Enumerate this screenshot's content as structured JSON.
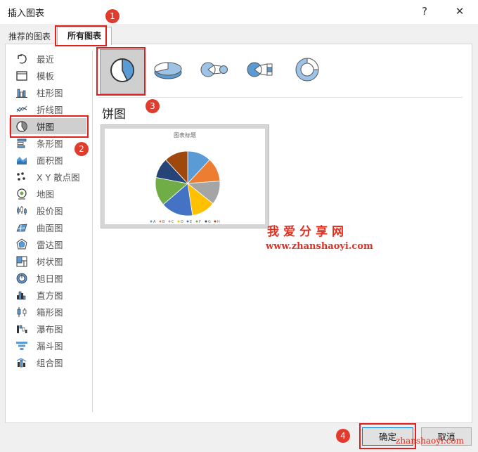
{
  "window": {
    "title": "插入图表",
    "help": "?",
    "close": "✕"
  },
  "tabs": {
    "recommended": "推荐的图表",
    "all": "所有图表"
  },
  "sidebar": {
    "items": [
      {
        "label": "最近",
        "icon": "recent-icon"
      },
      {
        "label": "模板",
        "icon": "template-icon"
      },
      {
        "label": "柱形图",
        "icon": "column-chart-icon"
      },
      {
        "label": "折线图",
        "icon": "line-chart-icon"
      },
      {
        "label": "饼图",
        "icon": "pie-chart-icon"
      },
      {
        "label": "条形图",
        "icon": "bar-chart-icon"
      },
      {
        "label": "面积图",
        "icon": "area-chart-icon"
      },
      {
        "label": "X Y 散点图",
        "icon": "scatter-chart-icon"
      },
      {
        "label": "地图",
        "icon": "map-chart-icon"
      },
      {
        "label": "股价图",
        "icon": "stock-chart-icon"
      },
      {
        "label": "曲面图",
        "icon": "surface-chart-icon"
      },
      {
        "label": "雷达图",
        "icon": "radar-chart-icon"
      },
      {
        "label": "树状图",
        "icon": "treemap-chart-icon"
      },
      {
        "label": "旭日图",
        "icon": "sunburst-chart-icon"
      },
      {
        "label": "直方图",
        "icon": "histogram-chart-icon"
      },
      {
        "label": "箱形图",
        "icon": "box-whisker-chart-icon"
      },
      {
        "label": "瀑布图",
        "icon": "waterfall-chart-icon"
      },
      {
        "label": "漏斗图",
        "icon": "funnel-chart-icon"
      },
      {
        "label": "组合图",
        "icon": "combo-chart-icon"
      }
    ],
    "active_index": 4
  },
  "subtypes": [
    "pie",
    "3d-pie",
    "pie-of-pie",
    "bar-of-pie",
    "doughnut"
  ],
  "selected_type_title": "饼图",
  "preview": {
    "title": "图表标题",
    "legend": [
      "A",
      "B",
      "C",
      "D",
      "E",
      "F",
      "G",
      "H"
    ]
  },
  "pie_colors": [
    "#5b9bd5",
    "#ed7d31",
    "#a5a5a5",
    "#ffc000",
    "#4472c4",
    "#70ad47",
    "#264478",
    "#9e480e"
  ],
  "pie_values": [
    1,
    1,
    1,
    1,
    1.35,
    1.2,
    0.85,
    1
  ],
  "annotations": [
    "1",
    "2",
    "3",
    "4"
  ],
  "watermark": {
    "title": "我爱分享网",
    "url": "www.zhanshaoyi.com",
    "corner": "zhanshaoyi.com"
  },
  "buttons": {
    "ok": "确定",
    "cancel": "取消"
  }
}
